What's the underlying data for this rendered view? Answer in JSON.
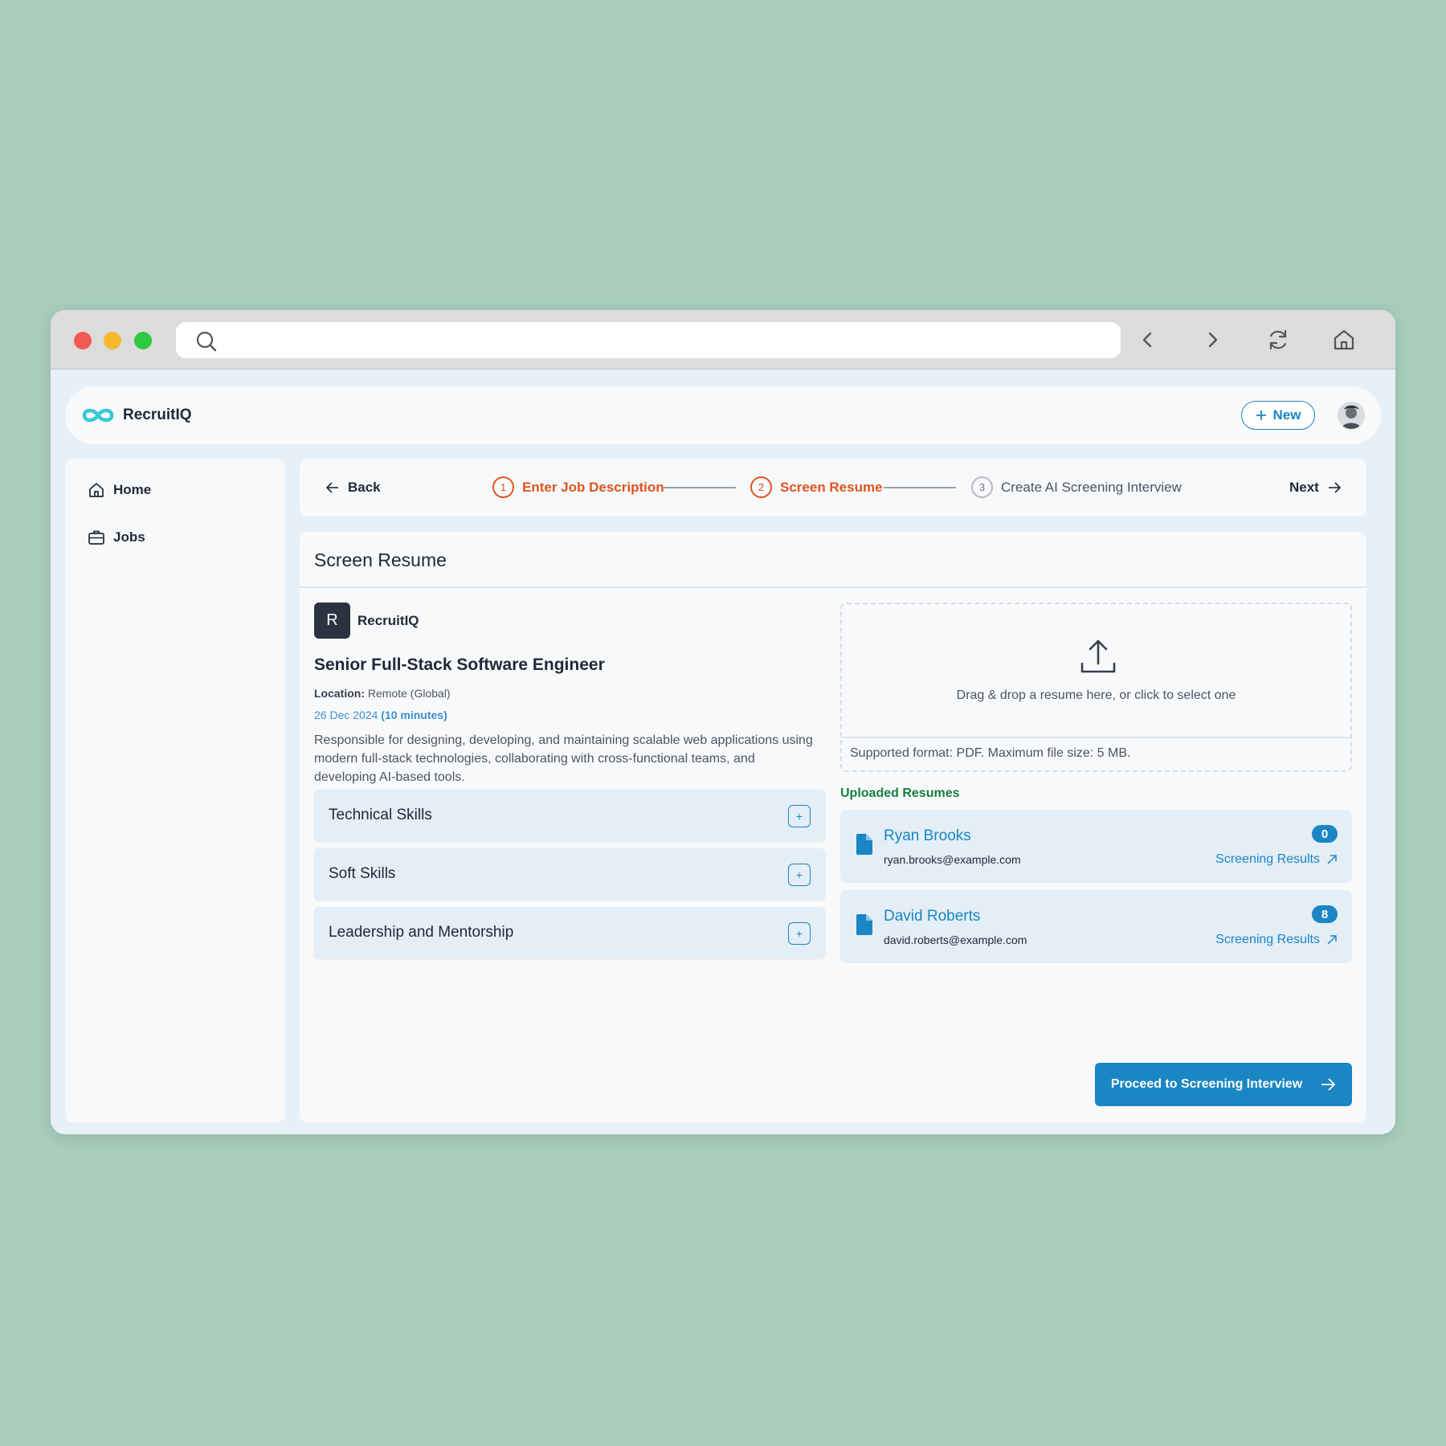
{
  "browser": {
    "url": "",
    "controls": [
      "close",
      "minimize",
      "maximize"
    ],
    "nav_icons": [
      "search-icon",
      "back-icon",
      "forward-icon",
      "reload-icon",
      "home-icon"
    ]
  },
  "app": {
    "brand": "RecruitIQ",
    "new_button": "New"
  },
  "sidebar": {
    "items": [
      {
        "label": "Home",
        "icon": "home-icon"
      },
      {
        "label": "Jobs",
        "icon": "briefcase-icon"
      }
    ]
  },
  "stepper": {
    "back": "Back",
    "next": "Next",
    "steps": [
      {
        "num": "1",
        "label": "Enter Job Description",
        "state": "active"
      },
      {
        "num": "2",
        "label": "Screen Resume",
        "state": "active"
      },
      {
        "num": "3",
        "label": "Create AI Screening Interview",
        "state": "inactive"
      }
    ]
  },
  "main": {
    "title": "Screen Resume",
    "company_initial": "R",
    "company_name": "RecruitIQ",
    "job_title": "Senior Full-Stack Software Engineer",
    "location_label": "Location:",
    "location_value": "Remote (Global)",
    "date": "26 Dec 2024",
    "duration": "(10 minutes)",
    "description": "Responsible for designing, developing, and maintaining scalable web applications using modern full-stack technologies, collaborating with cross-functional teams, and developing AI-based tools.",
    "skills": [
      "Technical Skills",
      "Soft Skills",
      "Leadership and Mentorship"
    ],
    "dropzone_text": "Drag & drop a resume here, or click to select one",
    "dropzone_note": "Supported format: PDF. Maximum file size: 5 MB.",
    "uploaded_heading": "Uploaded Resumes",
    "resumes": [
      {
        "name": "Ryan Brooks",
        "email": "ryan.brooks@example.com",
        "count": "0",
        "link": "Screening Results"
      },
      {
        "name": "David Roberts",
        "email": "david.roberts@example.com",
        "count": "8",
        "link": "Screening Results"
      }
    ],
    "proceed_button": "Proceed to Screening Interview"
  },
  "colors": {
    "accent": "#1a86c4",
    "step_active": "#e2531f",
    "uploaded_heading": "#15803d",
    "background": "#a8cdbd"
  }
}
